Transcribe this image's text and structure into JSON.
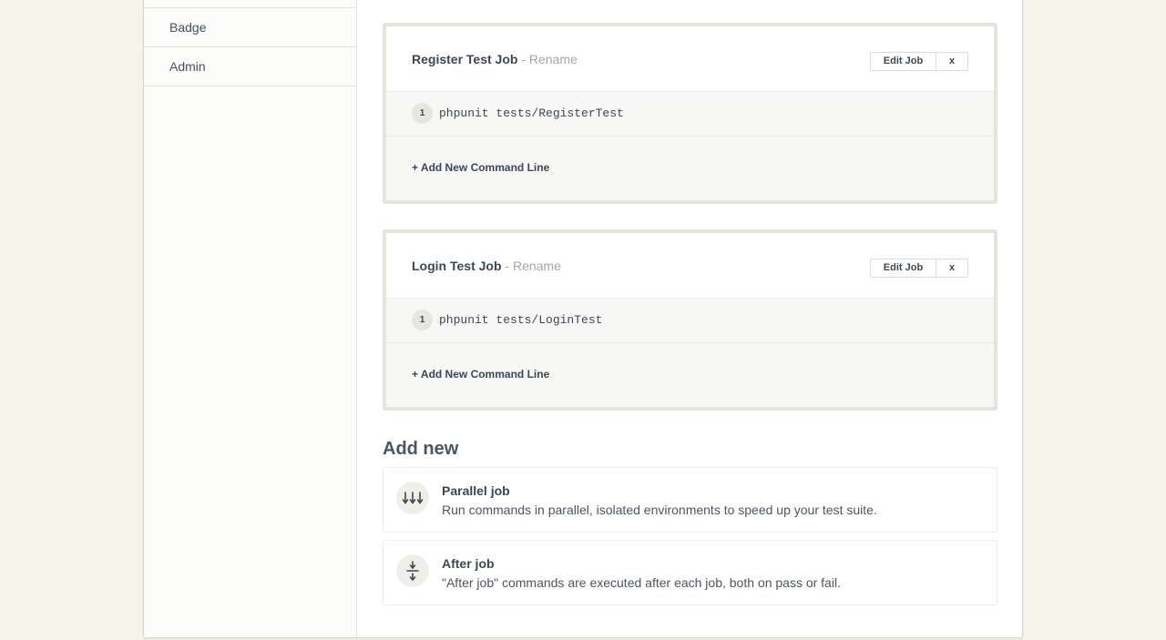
{
  "sidebar": {
    "items": [
      {
        "label": "Badge"
      },
      {
        "label": "Admin"
      }
    ]
  },
  "jobs": [
    {
      "title": "Register Test Job",
      "rename_label": " - Rename",
      "edit_label": "Edit Job",
      "delete_label": "x",
      "commands": [
        {
          "num": "1",
          "text": "phpunit tests/RegisterTest"
        }
      ],
      "add_command_label": "+ Add New Command Line"
    },
    {
      "title": "Login Test Job",
      "rename_label": " - Rename",
      "edit_label": "Edit Job",
      "delete_label": "x",
      "commands": [
        {
          "num": "1",
          "text": "phpunit tests/LoginTest"
        }
      ],
      "add_command_label": "+ Add New Command Line"
    }
  ],
  "add_new": {
    "title": "Add new",
    "options": [
      {
        "icon": "parallel-arrows-icon",
        "title": "Parallel job",
        "description": "Run commands in parallel, isolated environments to speed up your test suite."
      },
      {
        "icon": "after-job-icon",
        "title": "After job",
        "description": "\"After job\" commands are executed after each job, both on pass or fail."
      }
    ]
  }
}
